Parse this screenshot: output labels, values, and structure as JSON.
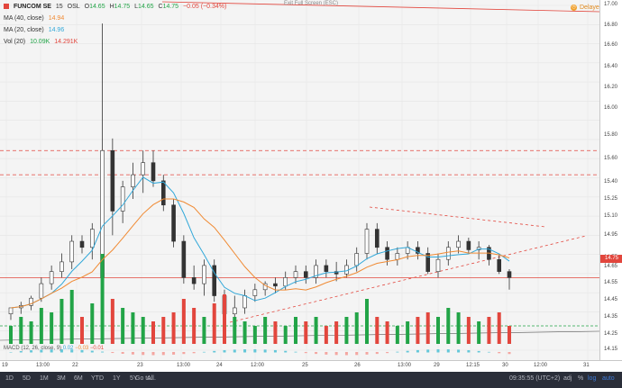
{
  "legend": {
    "symbol": "FUNCOM SE",
    "interval": "15",
    "exchange": "OSL",
    "open_label": "O",
    "open": "14.65",
    "high_label": "H",
    "high": "14.75",
    "low_label": "L",
    "low": "14.65",
    "close_label": "C",
    "close": "14.75",
    "change": "−0.05 (−0.34%)",
    "ma40_label": "MA (40, close)",
    "ma40_value": "14.94",
    "ma20_label": "MA (20, close)",
    "ma20_value": "14.96",
    "vol_label": "Vol (20)",
    "vol_value1": "10.09K",
    "vol_value2": "14.291K"
  },
  "macd": {
    "label": "MACD (12, 26, close, 9)",
    "v1": "0.02",
    "v2": "−0.03",
    "v3": "−0.01"
  },
  "exit_fullscreen": "Exit Full Screen (ESC)",
  "delayed": "Delayed",
  "price_axis": {
    "ticks": [
      "17.00",
      "16.80",
      "16.60",
      "16.40",
      "16.20",
      "16.00",
      "15.80",
      "15.60",
      "15.40",
      "15.25",
      "15.10",
      "14.95",
      "14.75",
      "14.65",
      "14.55",
      "14.45",
      "14.35",
      "14.25",
      "14.15"
    ],
    "current_price": "14.75"
  },
  "time_axis": {
    "labels": [
      "19",
      "13:00",
      "22",
      "23",
      "13:00",
      "24",
      "12:00",
      "25",
      "26",
      "13:00",
      "29",
      "12:15",
      "30",
      "12:00",
      "31"
    ]
  },
  "bottom_bar": {
    "ranges": [
      "1D",
      "5D",
      "1M",
      "3M",
      "6M",
      "YTD",
      "1Y",
      "5Y",
      "All"
    ],
    "goto": "Go to...",
    "clock": "09:35:55 (UTC+2)",
    "percent": "%",
    "log": "log",
    "auto": "auto",
    "adj": "adj"
  },
  "colors": {
    "up": "#22a447",
    "down": "#e2463d",
    "ma20": "#32a8d9",
    "ma40": "#f08a33",
    "trend": "#e2463d"
  },
  "chart_data": {
    "type": "candlestick",
    "price_range": [
      14.15,
      17.0
    ],
    "series_ohlc": [
      [
        14.45,
        14.5,
        14.4,
        14.5
      ],
      [
        14.5,
        14.55,
        14.45,
        14.52
      ],
      [
        14.52,
        14.6,
        14.48,
        14.58
      ],
      [
        14.58,
        14.75,
        14.55,
        14.7
      ],
      [
        14.7,
        14.85,
        14.65,
        14.8
      ],
      [
        14.8,
        14.95,
        14.75,
        14.88
      ],
      [
        14.88,
        15.1,
        14.82,
        15.05
      ],
      [
        15.05,
        15.1,
        14.95,
        15.0
      ],
      [
        15.0,
        15.2,
        14.9,
        15.15
      ],
      [
        14.75,
        16.85,
        14.7,
        15.8
      ],
      [
        15.8,
        15.9,
        15.1,
        15.3
      ],
      [
        15.3,
        15.55,
        15.2,
        15.5
      ],
      [
        15.5,
        15.7,
        15.4,
        15.6
      ],
      [
        15.6,
        15.8,
        15.45,
        15.7
      ],
      [
        15.7,
        15.8,
        15.5,
        15.55
      ],
      [
        15.55,
        15.6,
        15.3,
        15.35
      ],
      [
        15.35,
        15.4,
        15.0,
        15.05
      ],
      [
        15.05,
        15.1,
        14.7,
        14.75
      ],
      [
        14.75,
        14.85,
        14.65,
        14.7
      ],
      [
        14.7,
        14.9,
        14.6,
        14.85
      ],
      [
        14.85,
        14.9,
        14.55,
        14.6
      ],
      [
        14.6,
        14.65,
        14.4,
        14.45
      ],
      [
        14.45,
        14.6,
        14.35,
        14.5
      ],
      [
        14.5,
        14.65,
        14.45,
        14.6
      ],
      [
        14.6,
        14.7,
        14.55,
        14.65
      ],
      [
        14.65,
        14.72,
        14.6,
        14.7
      ],
      [
        14.7,
        14.75,
        14.62,
        14.68
      ],
      [
        14.68,
        14.8,
        14.65,
        14.75
      ],
      [
        14.75,
        14.85,
        14.7,
        14.8
      ],
      [
        14.8,
        14.85,
        14.7,
        14.75
      ],
      [
        14.75,
        14.9,
        14.7,
        14.85
      ],
      [
        14.85,
        14.9,
        14.75,
        14.8
      ],
      [
        14.8,
        14.88,
        14.72,
        14.78
      ],
      [
        14.78,
        14.9,
        14.75,
        14.85
      ],
      [
        14.85,
        15.0,
        14.8,
        14.95
      ],
      [
        14.95,
        15.2,
        14.9,
        15.15
      ],
      [
        15.15,
        15.2,
        14.95,
        15.0
      ],
      [
        15.0,
        15.05,
        14.85,
        14.9
      ],
      [
        14.9,
        15.0,
        14.85,
        14.95
      ],
      [
        14.95,
        15.05,
        14.9,
        15.0
      ],
      [
        15.0,
        15.05,
        14.9,
        14.95
      ],
      [
        14.95,
        15.0,
        14.78,
        14.8
      ],
      [
        14.8,
        14.95,
        14.75,
        14.9
      ],
      [
        14.9,
        15.05,
        14.85,
        15.0
      ],
      [
        15.0,
        15.1,
        14.95,
        15.05
      ],
      [
        15.05,
        15.08,
        14.95,
        14.98
      ],
      [
        14.98,
        15.05,
        14.9,
        15.0
      ],
      [
        15.0,
        15.02,
        14.85,
        14.9
      ],
      [
        14.9,
        14.95,
        14.78,
        14.8
      ],
      [
        14.8,
        14.82,
        14.65,
        14.75
      ]
    ],
    "volume_relative": [
      0.2,
      0.3,
      0.25,
      0.4,
      0.35,
      0.5,
      0.6,
      0.3,
      0.45,
      1.0,
      0.5,
      0.4,
      0.35,
      0.3,
      0.25,
      0.3,
      0.35,
      0.5,
      0.4,
      0.3,
      0.45,
      0.55,
      0.3,
      0.25,
      0.2,
      0.3,
      0.25,
      0.2,
      0.3,
      0.25,
      0.3,
      0.2,
      0.25,
      0.3,
      0.35,
      0.5,
      0.3,
      0.25,
      0.2,
      0.25,
      0.3,
      0.35,
      0.3,
      0.4,
      0.35,
      0.3,
      0.25,
      0.3,
      0.35,
      0.2
    ],
    "horizontal_levels": [
      15.8,
      15.6,
      14.75,
      14.2
    ]
  }
}
